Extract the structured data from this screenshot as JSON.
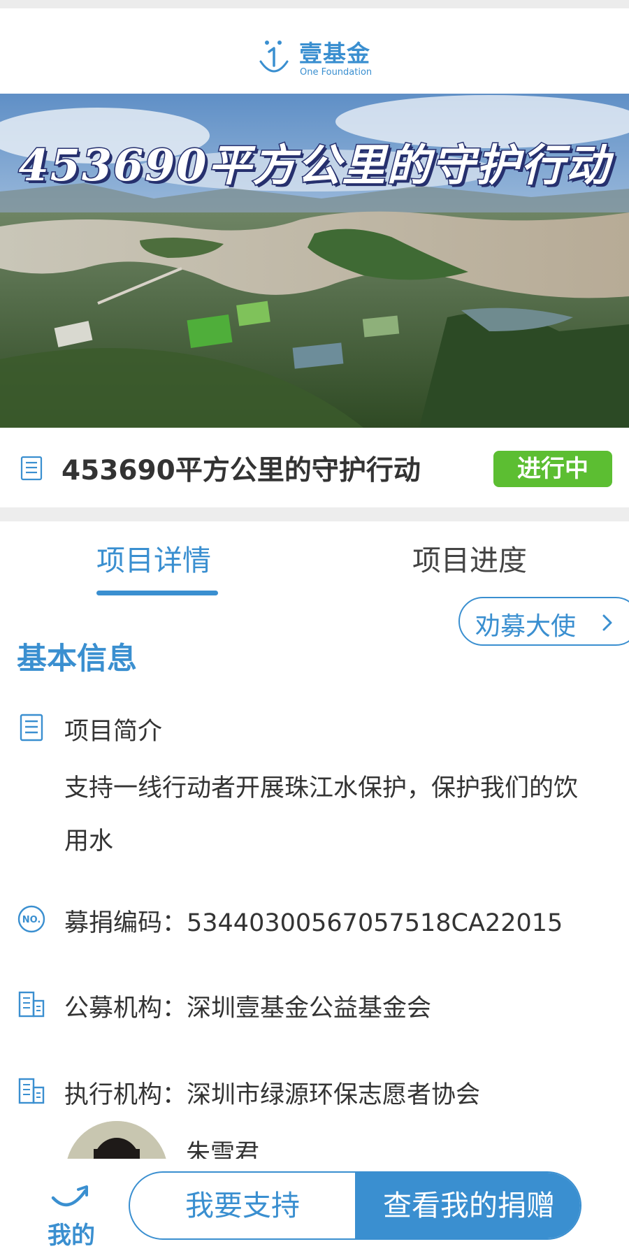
{
  "header": {
    "logo_cn": "壹基金",
    "logo_en": "One Foundation"
  },
  "banner": {
    "title": "453690平方公里的守护行动"
  },
  "project": {
    "title": "453690平方公里的守护行动",
    "status": "进行中"
  },
  "tabs": [
    {
      "label": "项目详情",
      "active": true
    },
    {
      "label": "项目进度",
      "active": false
    }
  ],
  "ambassador_button": "劝募大使",
  "basic_info": {
    "section_title": "基本信息",
    "intro_label": "项目简介",
    "intro_text": "支持一线行动者开展珠江水保护，保护我们的饮用水",
    "fundraising_code": "募捐编码：53440300567057518CA22015",
    "public_org": "公募机构：深圳壹基金公益基金会",
    "exec_org": "执行机构：深圳市绿源环保志愿者协会",
    "contact_name": "朱雪君"
  },
  "bottom_bar": {
    "mine_label": "我的",
    "support_label": "我要支持",
    "view_donation_label": "查看我的捐赠"
  },
  "colors": {
    "brand_blue": "#3a8fd0",
    "status_green": "#5cbe32",
    "banner_title_stroke": "#26306e"
  },
  "icons": [
    "logo-mark-icon",
    "list-icon",
    "doc-icon",
    "no-badge-icon",
    "building-icon",
    "chevron-right-icon",
    "mine-swoosh-icon"
  ]
}
